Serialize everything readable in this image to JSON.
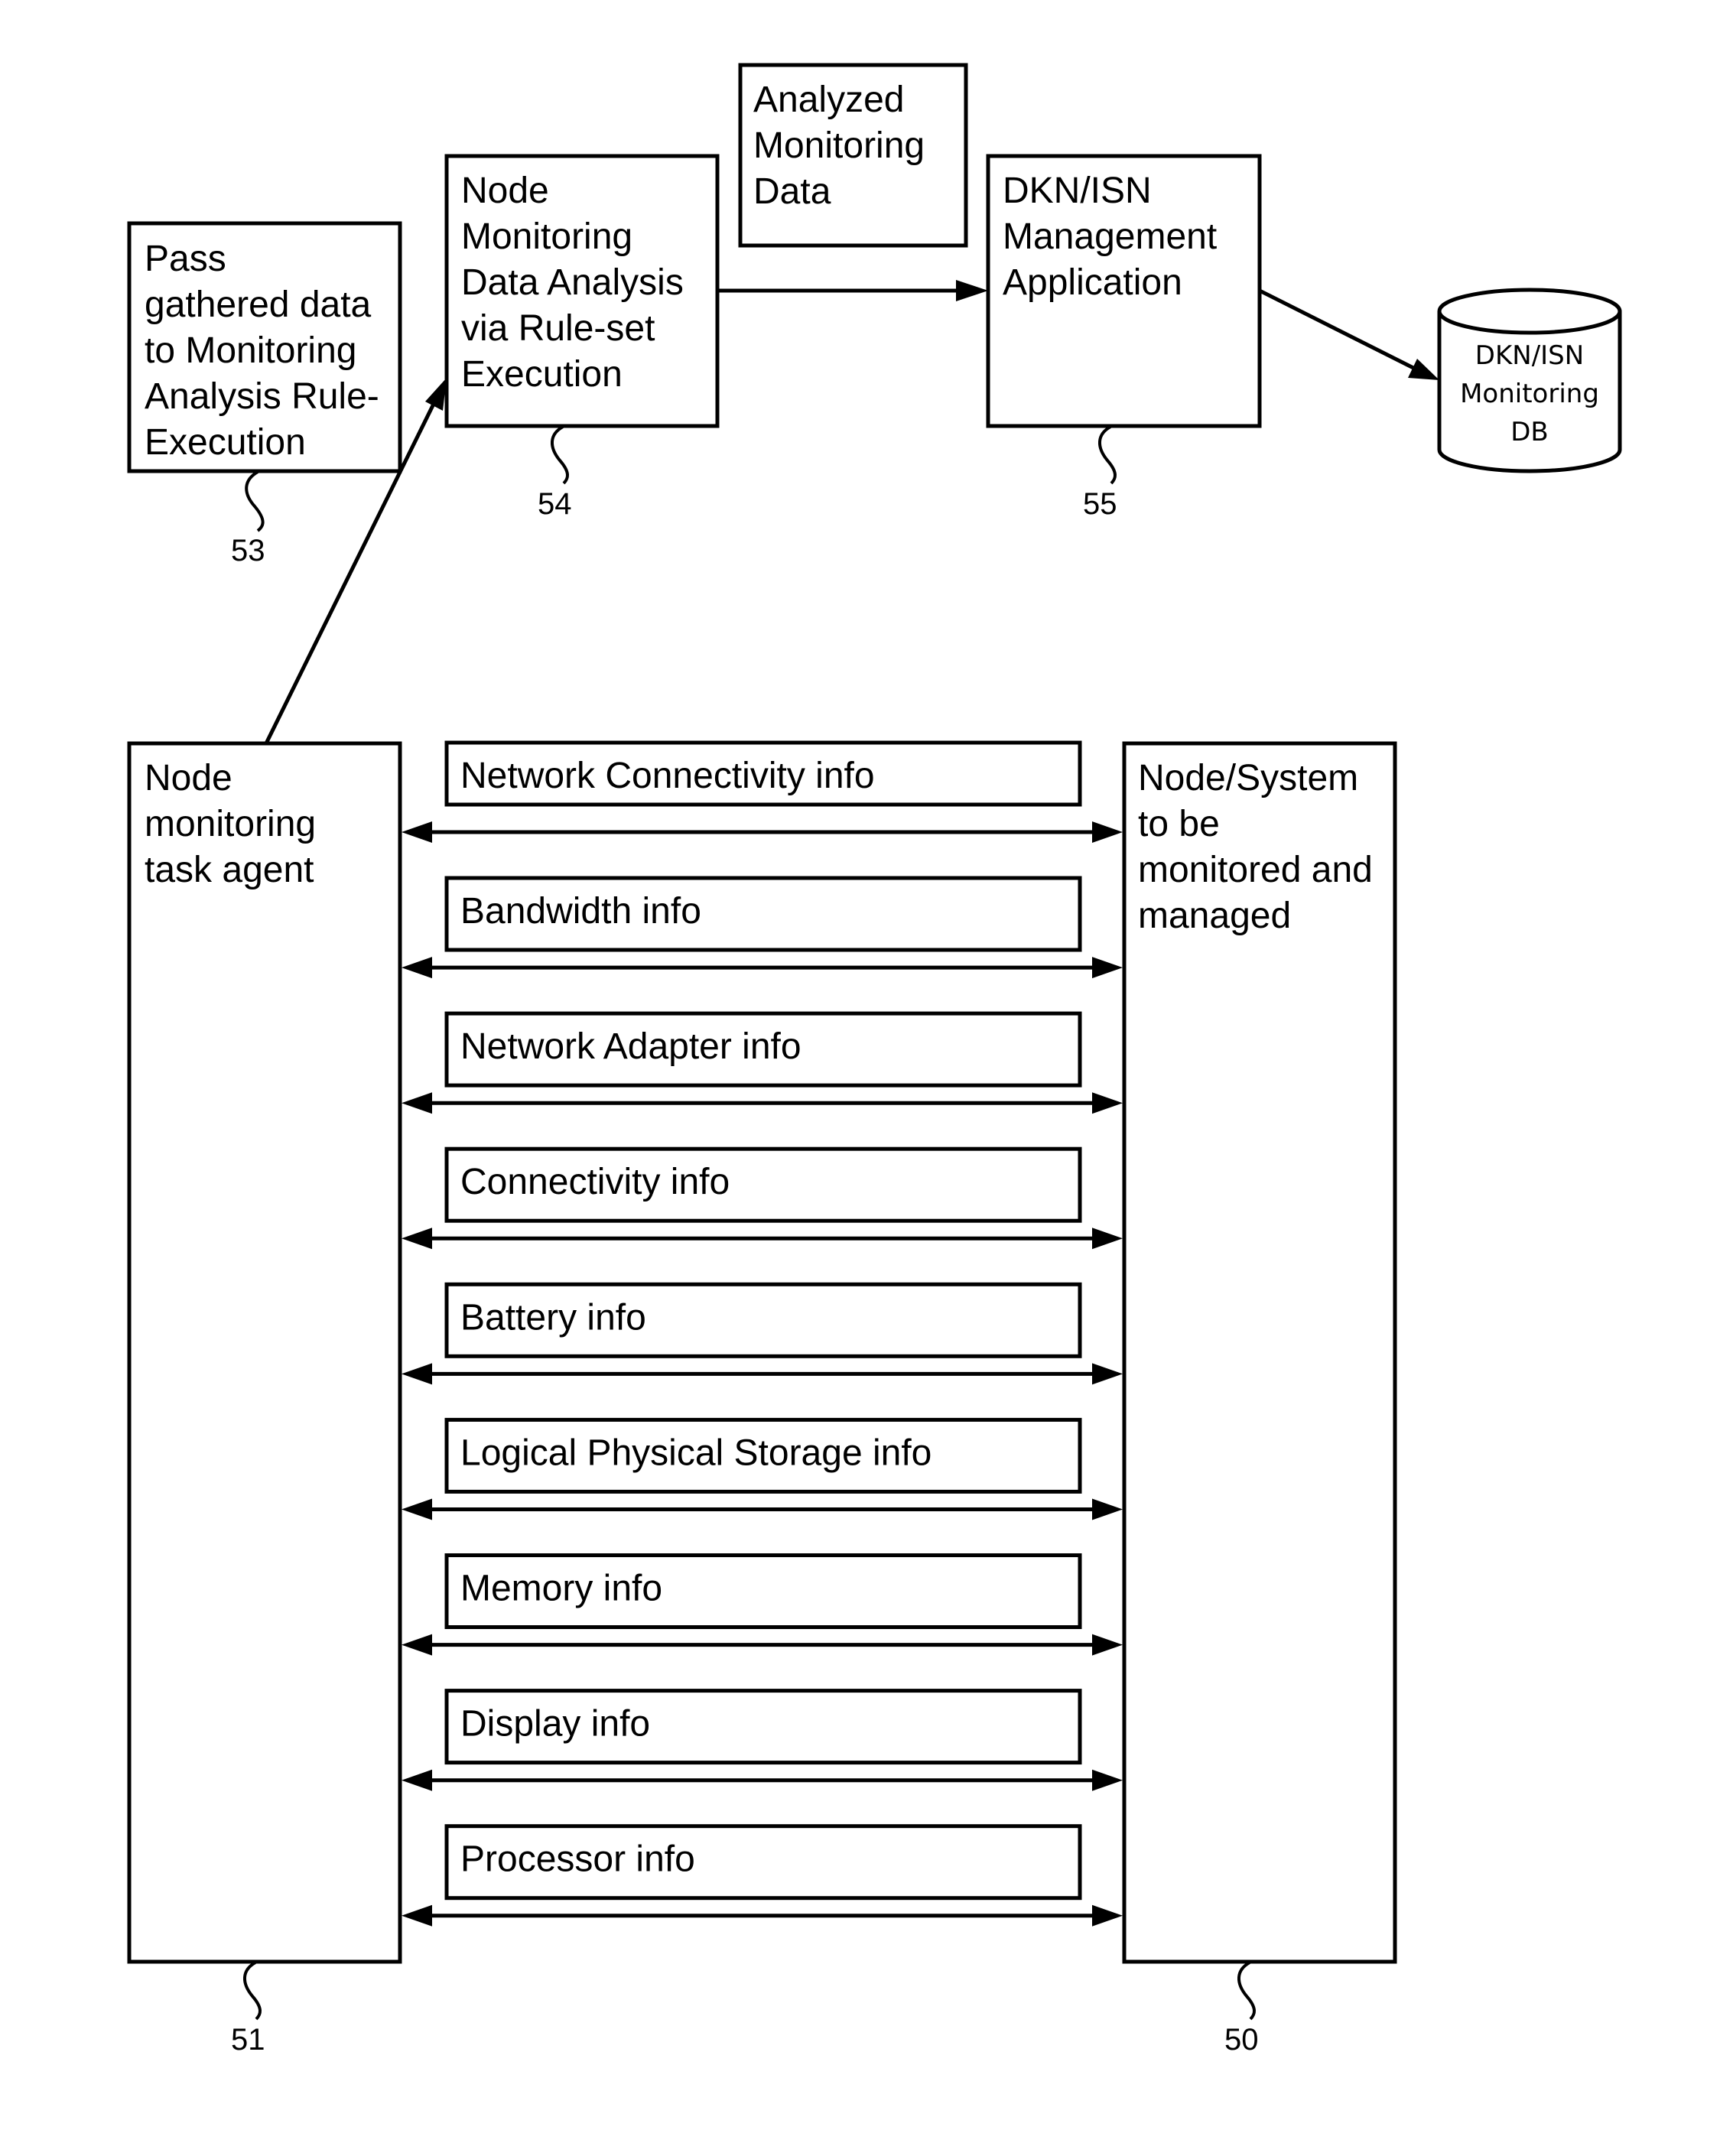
{
  "diagram": {
    "nodes": {
      "pass_data": {
        "ref": "53",
        "lines": [
          "Pass",
          "gathered data",
          "to Monitoring",
          "Analysis Rule-",
          "Execution"
        ]
      },
      "analysis": {
        "ref": "54",
        "lines": [
          "Node",
          "Monitoring",
          "Data Analysis",
          "via Rule-set",
          "Execution"
        ]
      },
      "analyzed_data": {
        "lines": [
          "Analyzed",
          "Monitoring",
          "Data"
        ]
      },
      "management_app": {
        "ref": "55",
        "lines": [
          "DKN/ISN",
          "Management",
          "Application"
        ]
      },
      "monitoring_db": {
        "lines": [
          "DKN/ISN",
          "Monitoring",
          "DB"
        ]
      },
      "task_agent": {
        "ref": "51",
        "lines": [
          "Node",
          "monitoring",
          "task agent"
        ]
      },
      "managed_node": {
        "ref": "50",
        "lines": [
          "Node/System",
          "to be",
          "monitored and",
          "managed"
        ]
      }
    },
    "info_items": [
      "Network Connectivity info",
      "Bandwidth info",
      "Network Adapter info",
      "Connectivity info",
      "Battery info",
      "Logical Physical Storage info",
      "Memory info",
      "Display info",
      "Processor info"
    ],
    "edges": [
      {
        "from": "task_agent",
        "to": "analysis",
        "type": "directed"
      },
      {
        "from": "analysis",
        "to": "management_app",
        "type": "directed"
      },
      {
        "from": "management_app",
        "to": "monitoring_db",
        "type": "directed"
      },
      {
        "from": "task_agent",
        "to": "managed_node",
        "type": "bidirectional",
        "count": 9
      }
    ]
  }
}
